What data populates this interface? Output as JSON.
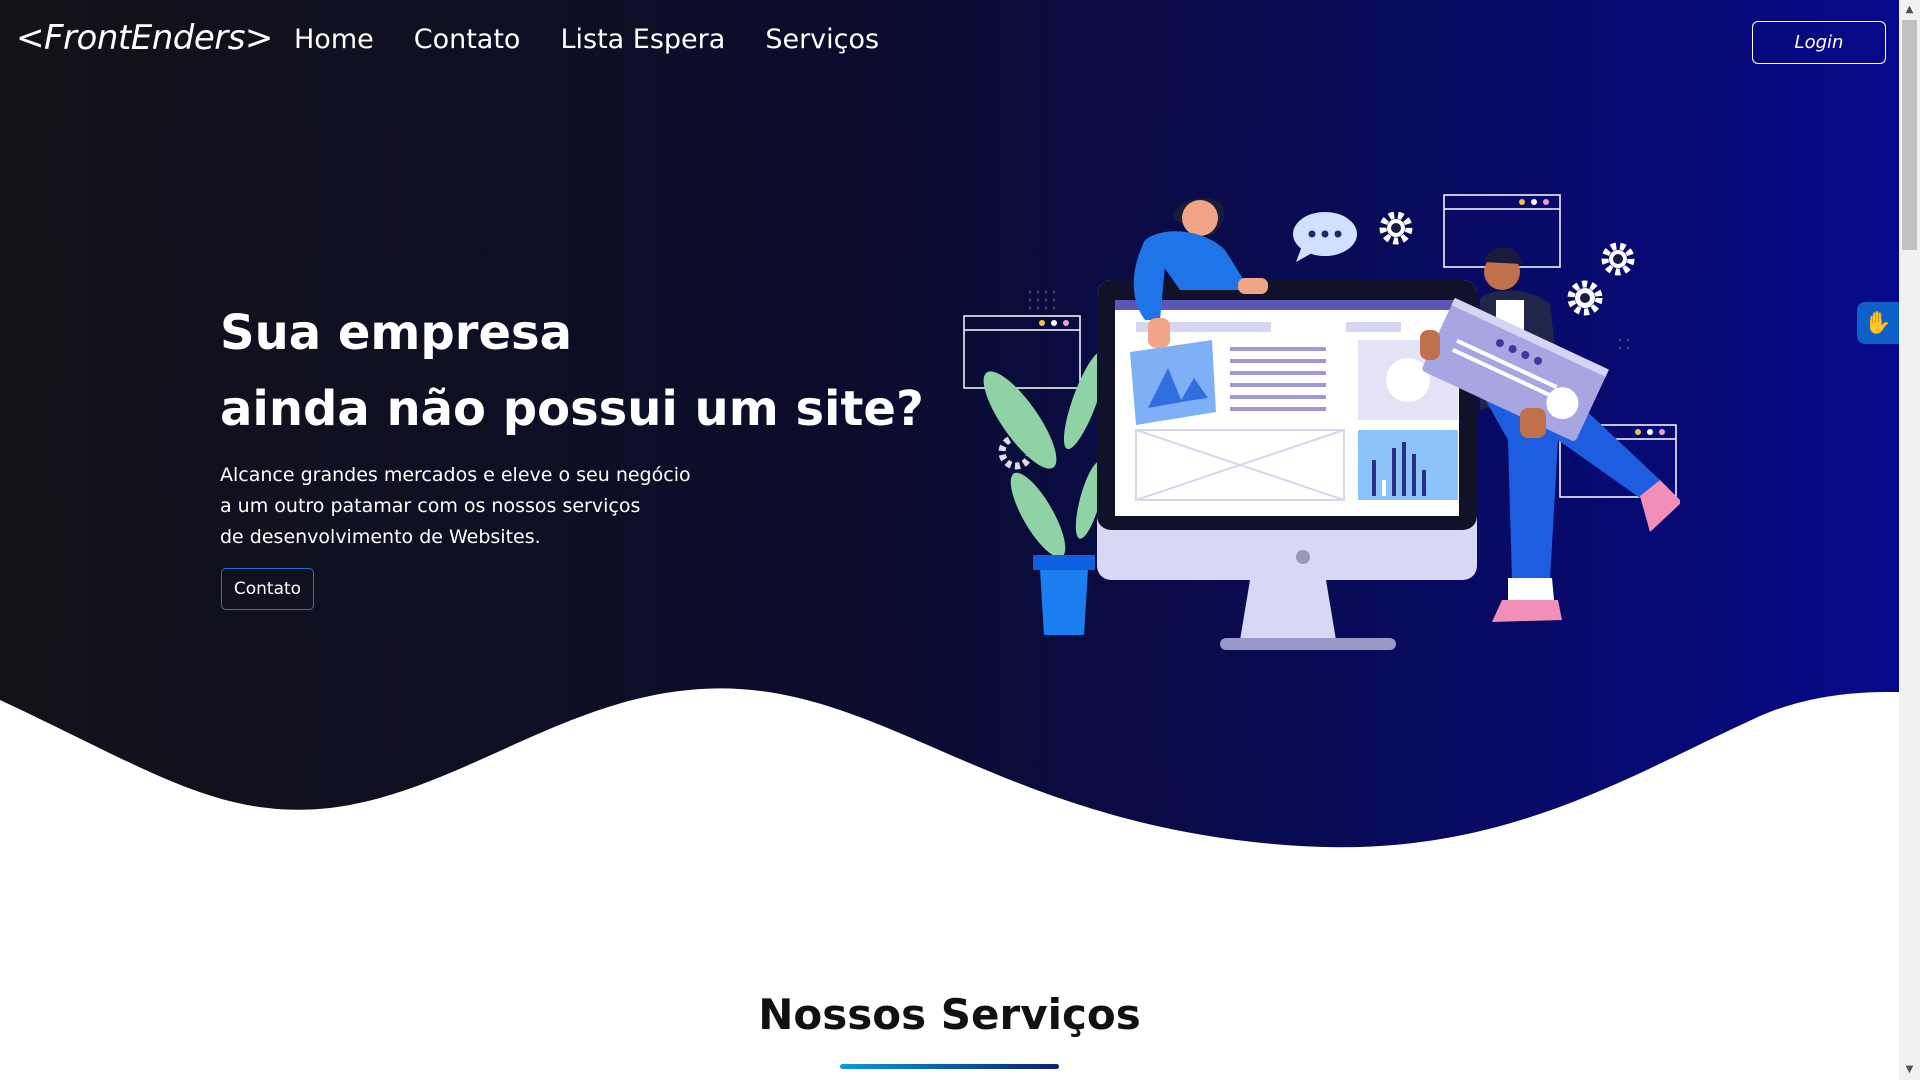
{
  "header": {
    "brand": "<FrontEnders>",
    "nav": [
      "Home",
      "Contato",
      "Lista Espera",
      "Serviços"
    ],
    "login_label": "Login"
  },
  "hero": {
    "headline_line1": "Sua empresa",
    "headline_line2": "ainda não possui um site?",
    "sub_line1": "Alcance grandes mercados e eleve o seu negócio",
    "sub_line2": "a um outro patamar com os nossos serviços",
    "sub_line3": "de desenvolvimento de Websites.",
    "button_label": "Contato"
  },
  "services": {
    "title": "Nossos Serviços"
  },
  "icons": {
    "accessibility": "sign-language-hand-icon",
    "illustration": "web-development-team-illustration"
  },
  "colors": {
    "hero_start": "#121218",
    "hero_end": "#060a8a",
    "accent": "#2d6bd6",
    "underline_start": "#0a9bd6",
    "underline_end": "#0b1e7a"
  }
}
